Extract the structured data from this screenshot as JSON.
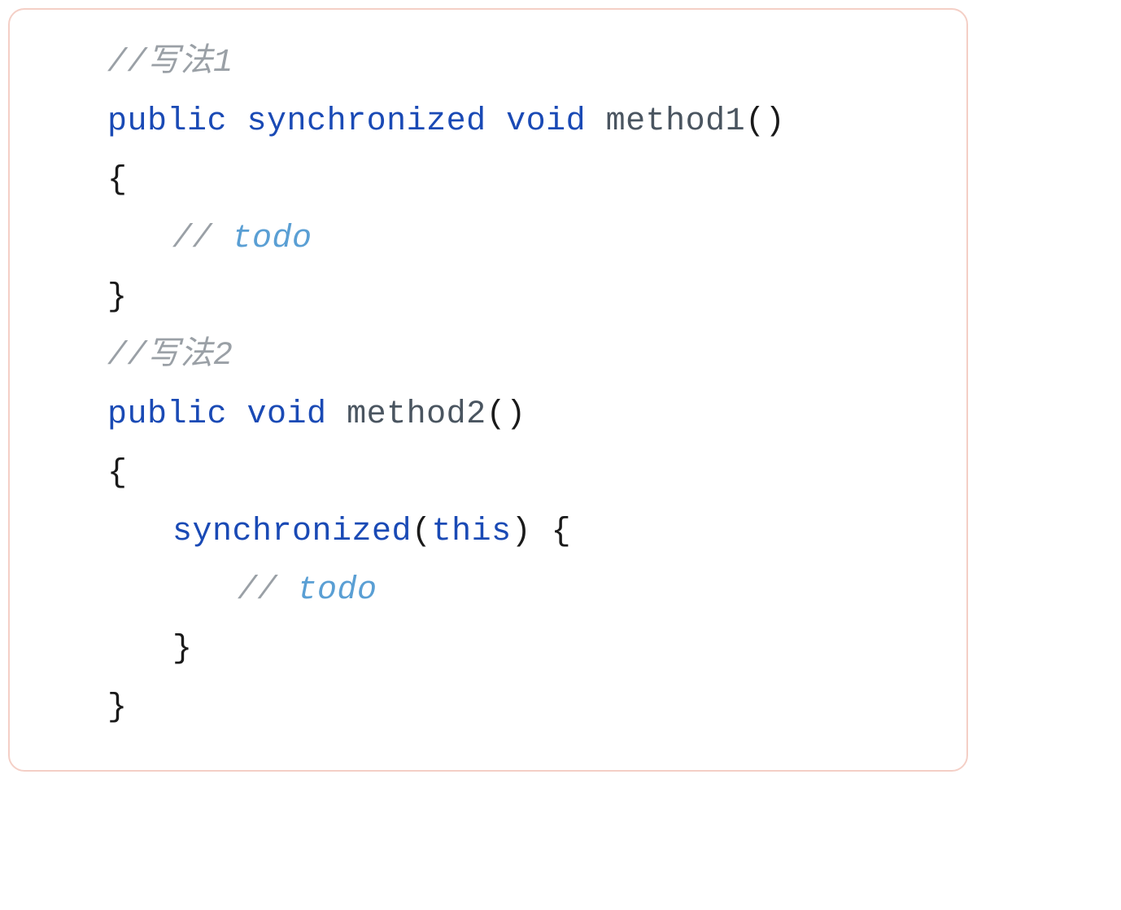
{
  "code": {
    "comment1": "//写法1",
    "line2_public": "public",
    "line2_sync": "synchronized",
    "line2_void": "void",
    "line2_method": "method1",
    "line2_parens": "()",
    "line3_brace": "{",
    "line4_slash": "// ",
    "line4_todo": "todo",
    "line5_brace": "}",
    "comment2": "//写法2",
    "line7_public": "public",
    "line7_void": "void",
    "line7_method": "method2",
    "line7_parens": "()",
    "line8_brace": "{",
    "line9_sync": "synchronized",
    "line9_this": "this",
    "line9_open": "(",
    "line9_close": ") {",
    "line10_slash": "// ",
    "line10_todo": "todo",
    "line11_brace": "}",
    "line12_brace": "}"
  }
}
